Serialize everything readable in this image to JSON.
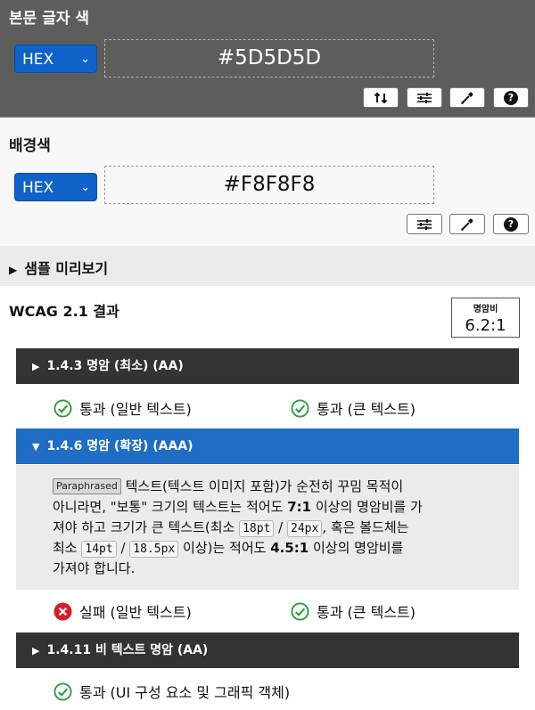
{
  "foreground": {
    "title": "본문 글자 색",
    "format": "HEX",
    "value": "#5D5D5D",
    "color": "#5D5D5D",
    "tools": [
      "swap-icon",
      "sliders-icon",
      "eyedropper-icon",
      "help-icon"
    ]
  },
  "background": {
    "title": "배경색",
    "format": "HEX",
    "value": "#F8F8F8",
    "color": "#F8F8F8",
    "tools": [
      "sliders-icon",
      "eyedropper-icon",
      "help-icon"
    ]
  },
  "preview": {
    "label": "샘플 미리보기"
  },
  "wcag": {
    "title": "WCAG 2.1 결과",
    "ratio_label": "명암비",
    "ratio_value": "6.2:1",
    "criteria": [
      {
        "title": "1.4.3 명암 (최소) (AA)",
        "expanded": false,
        "results": [
          {
            "status": "pass",
            "label": "통과 (일반 텍스트)"
          },
          {
            "status": "pass",
            "label": "통과 (큰 텍스트)"
          }
        ]
      },
      {
        "title": "1.4.6 명암 (확장) (AAA)",
        "expanded": true,
        "badge": "Paraphrased",
        "description": {
          "t1": "텍스트(텍스트 이미지 포함)가 순전히 꾸밈 목적이",
          "t2": "아니라면, \"보통\" 크기의 텍스트는 적어도 ",
          "ratio_normal": "7:1",
          "t3": " 이상의 명암비를 가",
          "t4": "져야 하고 크기가 큰 텍스트(최소 ",
          "size1": "18pt",
          "sep1": " / ",
          "size2": "24px",
          "t5": ", 혹은 볼드체는",
          "t6": "최소 ",
          "size3": "14pt",
          "sep2": " / ",
          "size4": "18.5px",
          "t7": " 이상)는 적어도 ",
          "ratio_large": "4.5:1",
          "t8": " 이상의 명암비를",
          "t9": "가져야 합니다."
        },
        "results": [
          {
            "status": "fail",
            "label": "실패 (일반 텍스트)"
          },
          {
            "status": "pass",
            "label": "통과 (큰 텍스트)"
          }
        ]
      },
      {
        "title": "1.4.11 비 텍스트 명암 (AA)",
        "expanded": false,
        "results": [
          {
            "status": "pass",
            "label": "통과 (UI 구성 요소 및 그래픽 객체)"
          }
        ]
      }
    ]
  },
  "colors": {
    "pass": "#2e9e3e",
    "fail": "#d21f2b",
    "accent": "#1f6dc4",
    "header_dark": "#333333"
  }
}
